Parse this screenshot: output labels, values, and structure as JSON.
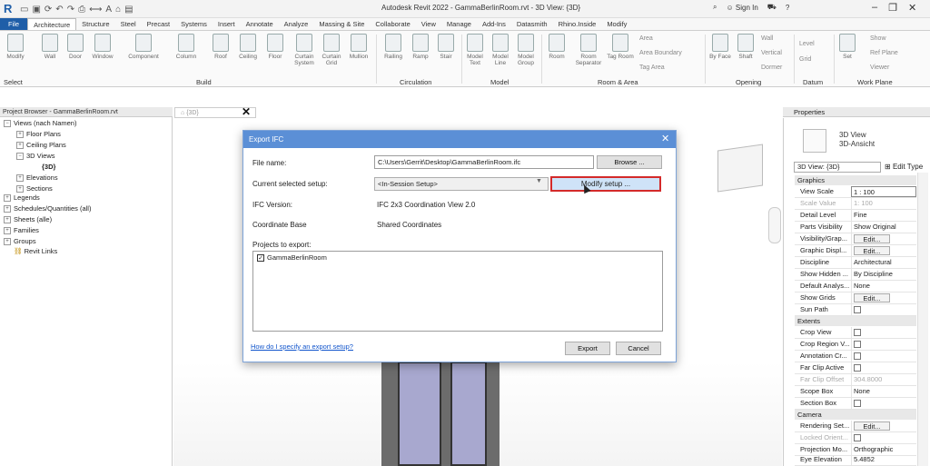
{
  "window": {
    "title": "Autodesk Revit 2022 - GammaBerlinRoom.rvt - 3D View: {3D}",
    "app_logo": "R",
    "sign_in": "Sign In",
    "help": "?"
  },
  "ribbon_tabs": [
    "File",
    "Architecture",
    "Structure",
    "Steel",
    "Precast",
    "Systems",
    "Insert",
    "Annotate",
    "Analyze",
    "Massing & Site",
    "Collaborate",
    "View",
    "Manage",
    "Add-Ins",
    "Datasmith",
    "Rhino.Inside",
    "Modify"
  ],
  "ribbon": {
    "buttons": {
      "modify": "Modify",
      "wall": "Wall",
      "door": "Door",
      "window": "Window",
      "component": "Component",
      "column": "Column",
      "roof": "Roof",
      "ceiling": "Ceiling",
      "floor": "Floor",
      "curtain_system": "Curtain System",
      "curtain_grid": "Curtain Grid",
      "mullion": "Mullion",
      "railing": "Railing",
      "ramp": "Ramp",
      "stair": "Stair",
      "model_text": "Model Text",
      "model_line": "Model Line",
      "model_group": "Model Group",
      "room": "Room",
      "room_separator": "Room Separator",
      "tag_room": "Tag Room",
      "area": "Area",
      "area_boundary": "Area Boundary",
      "tag_area": "Tag Area",
      "by_face": "By Face",
      "shaft": "Shaft",
      "wall_op": "Wall",
      "vertical": "Vertical",
      "dormer": "Dormer",
      "level": "Level",
      "grid": "Grid",
      "set": "Set",
      "show": "Show",
      "ref_plane": "Ref Plane",
      "viewer": "Viewer"
    },
    "groups": {
      "select": "Select",
      "build": "Build",
      "circulation": "Circulation",
      "model": "Model",
      "room_area": "Room & Area",
      "opening": "Opening",
      "datum": "Datum",
      "work_plane": "Work Plane"
    }
  },
  "project_browser": {
    "title": "Project Browser - GammaBerlinRoom.rvt",
    "items": {
      "views": "Views (nach Namen)",
      "floor_plans": "Floor Plans",
      "ceiling_plans": "Ceiling Plans",
      "views_3d": "3D Views",
      "view_3d": "{3D}",
      "elevations": "Elevations",
      "sections": "Sections",
      "legends": "Legends",
      "schedules": "Schedules/Quantities (all)",
      "sheets": "Sheets (alle)",
      "families": "Families",
      "groups": "Groups",
      "revit_links": "Revit Links"
    }
  },
  "view_tab": {
    "label": "{3D}",
    "close": "✕"
  },
  "dialog": {
    "title": "Export IFC",
    "close": "✕",
    "file_name_label": "File name:",
    "file_name_value": "C:\\Users\\Gerrit\\Desktop\\GammaBerlinRoom.ifc",
    "browse": "Browse ...",
    "setup_label": "Current selected setup:",
    "setup_value": "<In-Session Setup>",
    "modify_setup": "Modify setup ...",
    "ifc_version_label": "IFC Version:",
    "ifc_version_value": "IFC 2x3 Coordination View 2.0",
    "coord_base_label": "Coordinate Base",
    "coord_base_value": "Shared Coordinates",
    "projects_label": "Projects to export:",
    "project_name": "GammaBerlinRoom",
    "project_checked": "✓",
    "help_link": "How do I specify an export setup?",
    "export": "Export",
    "cancel": "Cancel"
  },
  "properties": {
    "title": "Properties",
    "type_name_1": "3D View",
    "type_name_2": "3D-Ansicht",
    "selector": "3D View: {3D}",
    "edit_type": "Edit Type",
    "edit_label": "Edit...",
    "cat_graphics": "Graphics",
    "cat_extents": "Extents",
    "cat_camera": "Camera",
    "rows": {
      "view_scale": {
        "name": "View Scale",
        "value": "1 : 100"
      },
      "scale_value": {
        "name": "Scale Value",
        "value": "1: 100"
      },
      "detail_level": {
        "name": "Detail Level",
        "value": "Fine"
      },
      "parts_visibility": {
        "name": "Parts Visibility",
        "value": "Show Original"
      },
      "visibility_graphics": {
        "name": "Visibility/Grap..."
      },
      "graphic_display": {
        "name": "Graphic Displ..."
      },
      "discipline": {
        "name": "Discipline",
        "value": "Architectural"
      },
      "show_hidden": {
        "name": "Show Hidden ...",
        "value": "By Discipline"
      },
      "default_analysis": {
        "name": "Default Analys...",
        "value": "None"
      },
      "show_grids": {
        "name": "Show Grids"
      },
      "sun_path": {
        "name": "Sun Path"
      },
      "crop_view": {
        "name": "Crop View"
      },
      "crop_region": {
        "name": "Crop Region V..."
      },
      "annotation_crop": {
        "name": "Annotation Cr..."
      },
      "far_clip_active": {
        "name": "Far Clip Active"
      },
      "far_clip_offset": {
        "name": "Far Clip Offset",
        "value": "304.8000"
      },
      "scope_box": {
        "name": "Scope Box",
        "value": "None"
      },
      "section_box": {
        "name": "Section Box"
      },
      "rendering_settings": {
        "name": "Rendering Set..."
      },
      "locked_orientation": {
        "name": "Locked Orient..."
      },
      "projection_mode": {
        "name": "Projection Mo...",
        "value": "Orthographic"
      },
      "eye_elevation": {
        "name": "Eye Elevation",
        "value": "5.4852"
      }
    }
  }
}
